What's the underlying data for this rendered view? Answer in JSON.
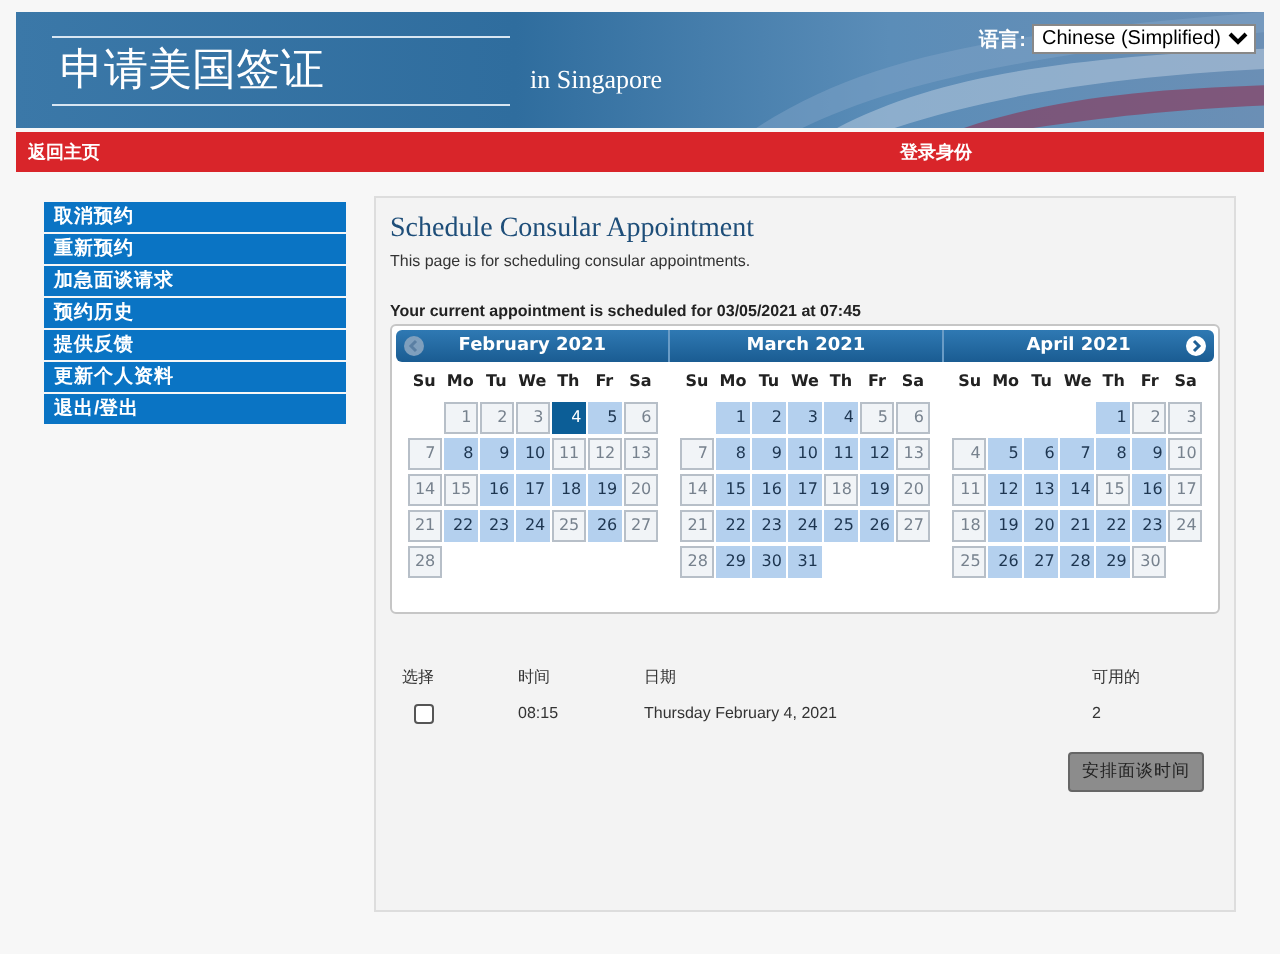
{
  "header": {
    "title": "申请美国签证",
    "subtitle": "in Singapore",
    "language_label": "语言:",
    "language_value": "Chinese (Simplified)"
  },
  "nav_bar": {
    "home_link": "返回主页",
    "login_label": "登录身份"
  },
  "sidebar": {
    "items": [
      {
        "label": "取消预约"
      },
      {
        "label": "重新预约"
      },
      {
        "label": "加急面谈请求"
      },
      {
        "label": "预约历史"
      },
      {
        "label": "提供反馈"
      },
      {
        "label": "更新个人资料"
      },
      {
        "label": "退出/登出"
      }
    ]
  },
  "main": {
    "title": "Schedule Consular Appointment",
    "description": "This page is for scheduling consular appointments.",
    "current_appointment": "Your current appointment is scheduled for 03/05/2021 at 07:45",
    "months": [
      {
        "title": "February 2021",
        "weekdays": [
          "Su",
          "Mo",
          "Tu",
          "We",
          "Th",
          "Fr",
          "Sa"
        ],
        "weeks": [
          {
            "days": [
              {
                "day": "1",
                "available": false,
                "selected": false
              },
              {
                "day": "2",
                "available": false,
                "selected": false
              },
              {
                "day": "3",
                "available": false,
                "selected": false
              },
              {
                "day": "4",
                "available": true,
                "selected": true
              },
              {
                "day": "5",
                "available": true,
                "selected": false
              },
              {
                "day": "6",
                "available": false,
                "selected": false
              }
            ]
          },
          {
            "days": [
              {
                "day": "7",
                "available": false,
                "selected": false
              },
              {
                "day": "8",
                "available": true,
                "selected": false
              },
              {
                "day": "9",
                "available": true,
                "selected": false
              },
              {
                "day": "10",
                "available": true,
                "selected": false
              },
              {
                "day": "11",
                "available": false,
                "selected": false
              },
              {
                "day": "12",
                "available": false,
                "selected": false
              },
              {
                "day": "13",
                "available": false,
                "selected": false
              }
            ]
          },
          {
            "days": [
              {
                "day": "14",
                "available": false,
                "selected": false
              },
              {
                "day": "15",
                "available": false,
                "selected": false
              },
              {
                "day": "16",
                "available": true,
                "selected": false
              },
              {
                "day": "17",
                "available": true,
                "selected": false
              },
              {
                "day": "18",
                "available": true,
                "selected": false
              },
              {
                "day": "19",
                "available": true,
                "selected": false
              },
              {
                "day": "20",
                "available": false,
                "selected": false
              }
            ]
          },
          {
            "days": [
              {
                "day": "21",
                "available": false,
                "selected": false
              },
              {
                "day": "22",
                "available": true,
                "selected": false
              },
              {
                "day": "23",
                "available": true,
                "selected": false
              },
              {
                "day": "24",
                "available": true,
                "selected": false
              },
              {
                "day": "25",
                "available": false,
                "selected": false
              },
              {
                "day": "26",
                "available": true,
                "selected": false
              },
              {
                "day": "27",
                "available": false,
                "selected": false
              }
            ]
          },
          {
            "days": [
              {
                "day": "28",
                "available": false,
                "selected": false
              }
            ]
          }
        ]
      },
      {
        "title": "March 2021",
        "weekdays": [
          "Su",
          "Mo",
          "Tu",
          "We",
          "Th",
          "Fr",
          "Sa"
        ],
        "weeks": [
          {
            "days": [
              {
                "day": "1",
                "available": true,
                "selected": false
              },
              {
                "day": "2",
                "available": true,
                "selected": false
              },
              {
                "day": "3",
                "available": true,
                "selected": false
              },
              {
                "day": "4",
                "available": true,
                "selected": false
              },
              {
                "day": "5",
                "available": false,
                "selected": false
              },
              {
                "day": "6",
                "available": false,
                "selected": false
              }
            ]
          },
          {
            "days": [
              {
                "day": "7",
                "available": false,
                "selected": false
              },
              {
                "day": "8",
                "available": true,
                "selected": false
              },
              {
                "day": "9",
                "available": true,
                "selected": false
              },
              {
                "day": "10",
                "available": true,
                "selected": false
              },
              {
                "day": "11",
                "available": true,
                "selected": false
              },
              {
                "day": "12",
                "available": true,
                "selected": false
              },
              {
                "day": "13",
                "available": false,
                "selected": false
              }
            ]
          },
          {
            "days": [
              {
                "day": "14",
                "available": false,
                "selected": false
              },
              {
                "day": "15",
                "available": true,
                "selected": false
              },
              {
                "day": "16",
                "available": true,
                "selected": false
              },
              {
                "day": "17",
                "available": true,
                "selected": false
              },
              {
                "day": "18",
                "available": false,
                "selected": false
              },
              {
                "day": "19",
                "available": true,
                "selected": false
              },
              {
                "day": "20",
                "available": false,
                "selected": false
              }
            ]
          },
          {
            "days": [
              {
                "day": "21",
                "available": false,
                "selected": false
              },
              {
                "day": "22",
                "available": true,
                "selected": false
              },
              {
                "day": "23",
                "available": true,
                "selected": false
              },
              {
                "day": "24",
                "available": true,
                "selected": false
              },
              {
                "day": "25",
                "available": true,
                "selected": false
              },
              {
                "day": "26",
                "available": true,
                "selected": false
              },
              {
                "day": "27",
                "available": false,
                "selected": false
              }
            ]
          },
          {
            "days": [
              {
                "day": "28",
                "available": false,
                "selected": false
              },
              {
                "day": "29",
                "available": true,
                "selected": false
              },
              {
                "day": "30",
                "available": true,
                "selected": false
              },
              {
                "day": "31",
                "available": true,
                "selected": false
              }
            ]
          }
        ]
      },
      {
        "title": "April 2021",
        "weekdays": [
          "Su",
          "Mo",
          "Tu",
          "We",
          "Th",
          "Fr",
          "Sa"
        ],
        "weeks": [
          {
            "days": [
              {
                "day": "1",
                "available": true,
                "selected": false
              },
              {
                "day": "2",
                "available": false,
                "selected": false
              },
              {
                "day": "3",
                "available": false,
                "selected": false
              }
            ]
          },
          {
            "days": [
              {
                "day": "4",
                "available": false,
                "selected": false
              },
              {
                "day": "5",
                "available": true,
                "selected": false
              },
              {
                "day": "6",
                "available": true,
                "selected": false
              },
              {
                "day": "7",
                "available": true,
                "selected": false
              },
              {
                "day": "8",
                "available": true,
                "selected": false
              },
              {
                "day": "9",
                "available": true,
                "selected": false
              },
              {
                "day": "10",
                "available": false,
                "selected": false
              }
            ]
          },
          {
            "days": [
              {
                "day": "11",
                "available": false,
                "selected": false
              },
              {
                "day": "12",
                "available": true,
                "selected": false
              },
              {
                "day": "13",
                "available": true,
                "selected": false
              },
              {
                "day": "14",
                "available": true,
                "selected": false
              },
              {
                "day": "15",
                "available": false,
                "selected": false
              },
              {
                "day": "16",
                "available": true,
                "selected": false
              },
              {
                "day": "17",
                "available": false,
                "selected": false
              }
            ]
          },
          {
            "days": [
              {
                "day": "18",
                "available": false,
                "selected": false
              },
              {
                "day": "19",
                "available": true,
                "selected": false
              },
              {
                "day": "20",
                "available": true,
                "selected": false
              },
              {
                "day": "21",
                "available": true,
                "selected": false
              },
              {
                "day": "22",
                "available": true,
                "selected": false
              },
              {
                "day": "23",
                "available": true,
                "selected": false
              },
              {
                "day": "24",
                "available": false,
                "selected": false
              }
            ]
          },
          {
            "days": [
              {
                "day": "25",
                "available": false,
                "selected": false
              },
              {
                "day": "26",
                "available": true,
                "selected": false
              },
              {
                "day": "27",
                "available": true,
                "selected": false
              },
              {
                "day": "28",
                "available": true,
                "selected": false
              },
              {
                "day": "29",
                "available": true,
                "selected": false
              },
              {
                "day": "30",
                "available": false,
                "selected": false
              }
            ]
          }
        ]
      }
    ],
    "slots": {
      "columns": [
        "选择",
        "时间",
        "日期",
        "可用的"
      ],
      "rows": [
        {
          "checked": false,
          "time": "08:15",
          "date": "Thursday February 4, 2021",
          "available": "2"
        }
      ]
    },
    "submit_button": "安排面谈时间"
  }
}
